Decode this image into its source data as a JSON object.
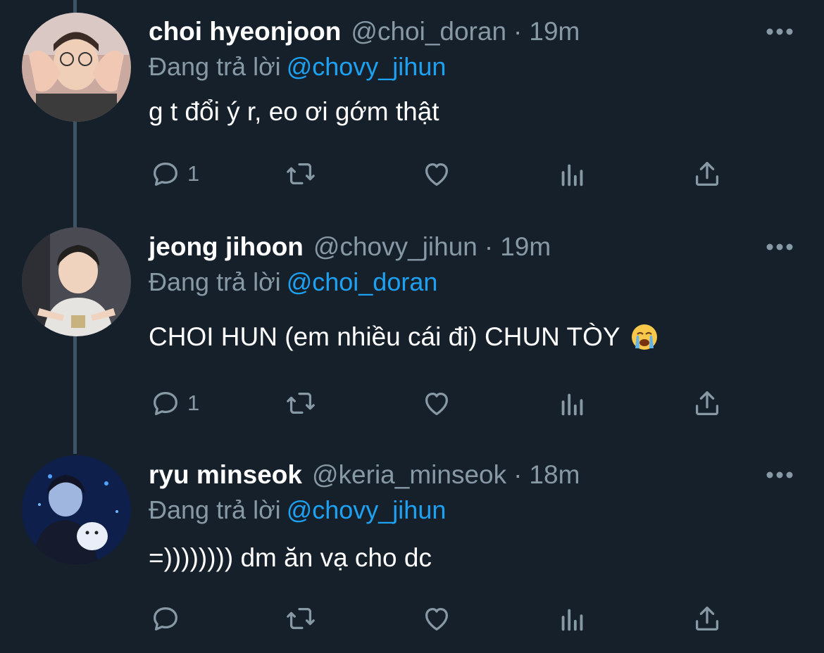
{
  "reply_prefix": "Đang trả lời",
  "separator": "·",
  "icons": {
    "reply": "reply-bubble-icon",
    "retweet": "retweet-icon",
    "like": "heart-icon",
    "analytics": "analytics-bars-icon",
    "share": "share-upload-icon",
    "more": "more-dots-icon"
  },
  "colors": {
    "background": "#15202b",
    "link": "#1da1f2",
    "muted": "#8899a6",
    "thread_line": "#3d5466"
  },
  "tweets": [
    {
      "display_name": "choi hyeonjoon",
      "handle": "@choi_doran",
      "time": "19m",
      "reply_to": "@chovy_jihun",
      "text": "g t đổi ý r, eo ơi gớm thật",
      "reply_count": "1"
    },
    {
      "display_name": "jeong jihoon",
      "handle": "@chovy_jihun",
      "time": "19m",
      "reply_to": "@choi_doran",
      "text": "CHOI HUN (em nhiều cái đi) CHUN TÒY",
      "emoji": "loudly-crying-face-emoji",
      "reply_count": "1"
    },
    {
      "display_name": "ryu minseok",
      "handle": "@keria_minseok",
      "time": "18m",
      "reply_to": "@chovy_jihun",
      "text": "=)))))))) dm ăn vạ cho dc",
      "reply_count": ""
    }
  ]
}
